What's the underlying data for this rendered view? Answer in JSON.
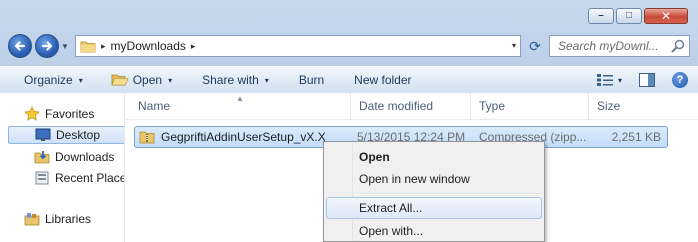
{
  "window": {
    "minimize": "–",
    "maximize": "□",
    "close": "✕"
  },
  "address_bar": {
    "separator": "▸",
    "crumbs": [
      "myDownloads"
    ],
    "dropdown": "▾"
  },
  "search": {
    "placeholder": "Search myDownl..."
  },
  "toolbar": {
    "organize": "Organize",
    "open": "Open",
    "share_with": "Share with",
    "burn": "Burn",
    "new_folder": "New folder",
    "dropdown_glyph": "▾",
    "help_glyph": "?"
  },
  "nav_pane": {
    "favorites": "Favorites",
    "items": [
      "Desktop",
      "Downloads",
      "Recent Places"
    ],
    "libraries": "Libraries"
  },
  "columns": {
    "name": "Name",
    "date": "Date modified",
    "type": "Type",
    "size": "Size",
    "sort_caret": "▲"
  },
  "files": [
    {
      "name": "GegpriftiAddinUserSetup_vX.X.X",
      "date": "5/13/2015 12:24 PM",
      "type": "Compressed (zipp...",
      "size": "2,251 KB"
    }
  ],
  "context_menu": {
    "items": [
      "Open",
      "Open in new window",
      "Extract All...",
      "Open with..."
    ]
  },
  "colors": {
    "accent": "#1e395b",
    "selection": "#c1dcfa",
    "menu_bg": "#f0f0f0"
  }
}
